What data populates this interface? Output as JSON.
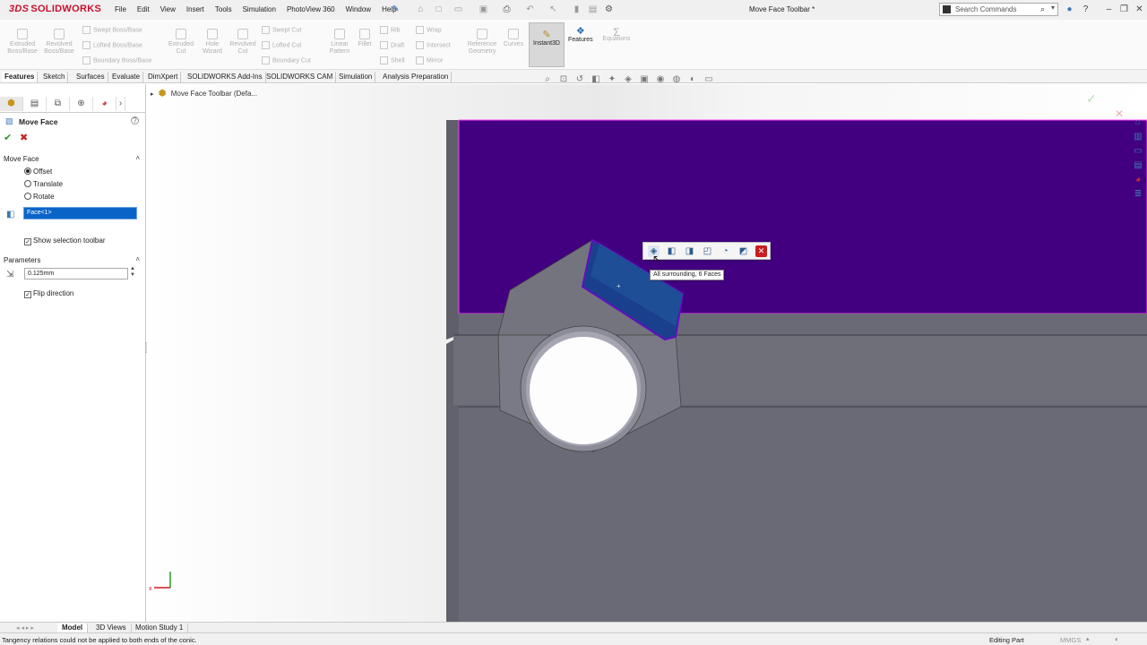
{
  "app": {
    "title": "Move Face Toolbar *",
    "brand": "SOLIDWORKS"
  },
  "menu": [
    "File",
    "Edit",
    "View",
    "Insert",
    "Tools",
    "Simulation",
    "PhotoView 360",
    "Window",
    "Help"
  ],
  "search": {
    "placeholder": "Search Commands"
  },
  "command_manager": {
    "extruded_boss": "Extruded Boss/Base",
    "revolved_boss": "Revolved Boss/Base",
    "swept_boss": "Swept Boss/Base",
    "lofted_boss": "Lofted Boss/Base",
    "boundary_boss": "Boundary Boss/Base",
    "extruded_cut": "Extruded Cut",
    "hole_wizard": "Hole Wizard",
    "revolved_cut": "Revolved Cut",
    "swept_cut": "Swept Cut",
    "lofted_cut": "Lofted Cut",
    "boundary_cut": "Boundary Cut",
    "linear_pattern": "Linear Pattern",
    "fillet": "Fillet",
    "rib": "Rib",
    "draft": "Draft",
    "shell": "Shell",
    "wrap": "Wrap",
    "intersect": "Intersect",
    "mirror": "Mirror",
    "reference_geometry": "Reference Geometry",
    "curves": "Curves",
    "instant3d": "Instant3D",
    "features": "Features",
    "equations": "Equations"
  },
  "tabs": [
    "Features",
    "Sketch",
    "Surfaces",
    "Evaluate",
    "DimXpert",
    "SOLIDWORKS Add-Ins",
    "SOLIDWORKS CAM",
    "Simulation",
    "Analysis Preparation"
  ],
  "tree_item": "Move Face Toolbar  (Defa...",
  "property_manager": {
    "title": "Move Face",
    "move_face_section": "Move Face",
    "options": [
      "Offset",
      "Translate",
      "Rotate"
    ],
    "selected_option": "Offset",
    "face_selection": "Face<1>",
    "show_selection_toolbar": "Show selection toolbar",
    "parameters_section": "Parameters",
    "offset_value": "0.125mm",
    "flip_direction": "Flip direction"
  },
  "selection_toolbar": {
    "tooltip": "All surrounding, 6 Faces"
  },
  "bottom_tabs": [
    "Model",
    "3D Views",
    "Motion Study 1"
  ],
  "status": {
    "message": "Tangency relations could not be applied to both ends of the conic.",
    "mode": "Editing Part",
    "units": "MMGS"
  },
  "colors": {
    "selected_face": "#420080",
    "highlight": "#0a64c8",
    "part_grey": "#6b6b78"
  }
}
